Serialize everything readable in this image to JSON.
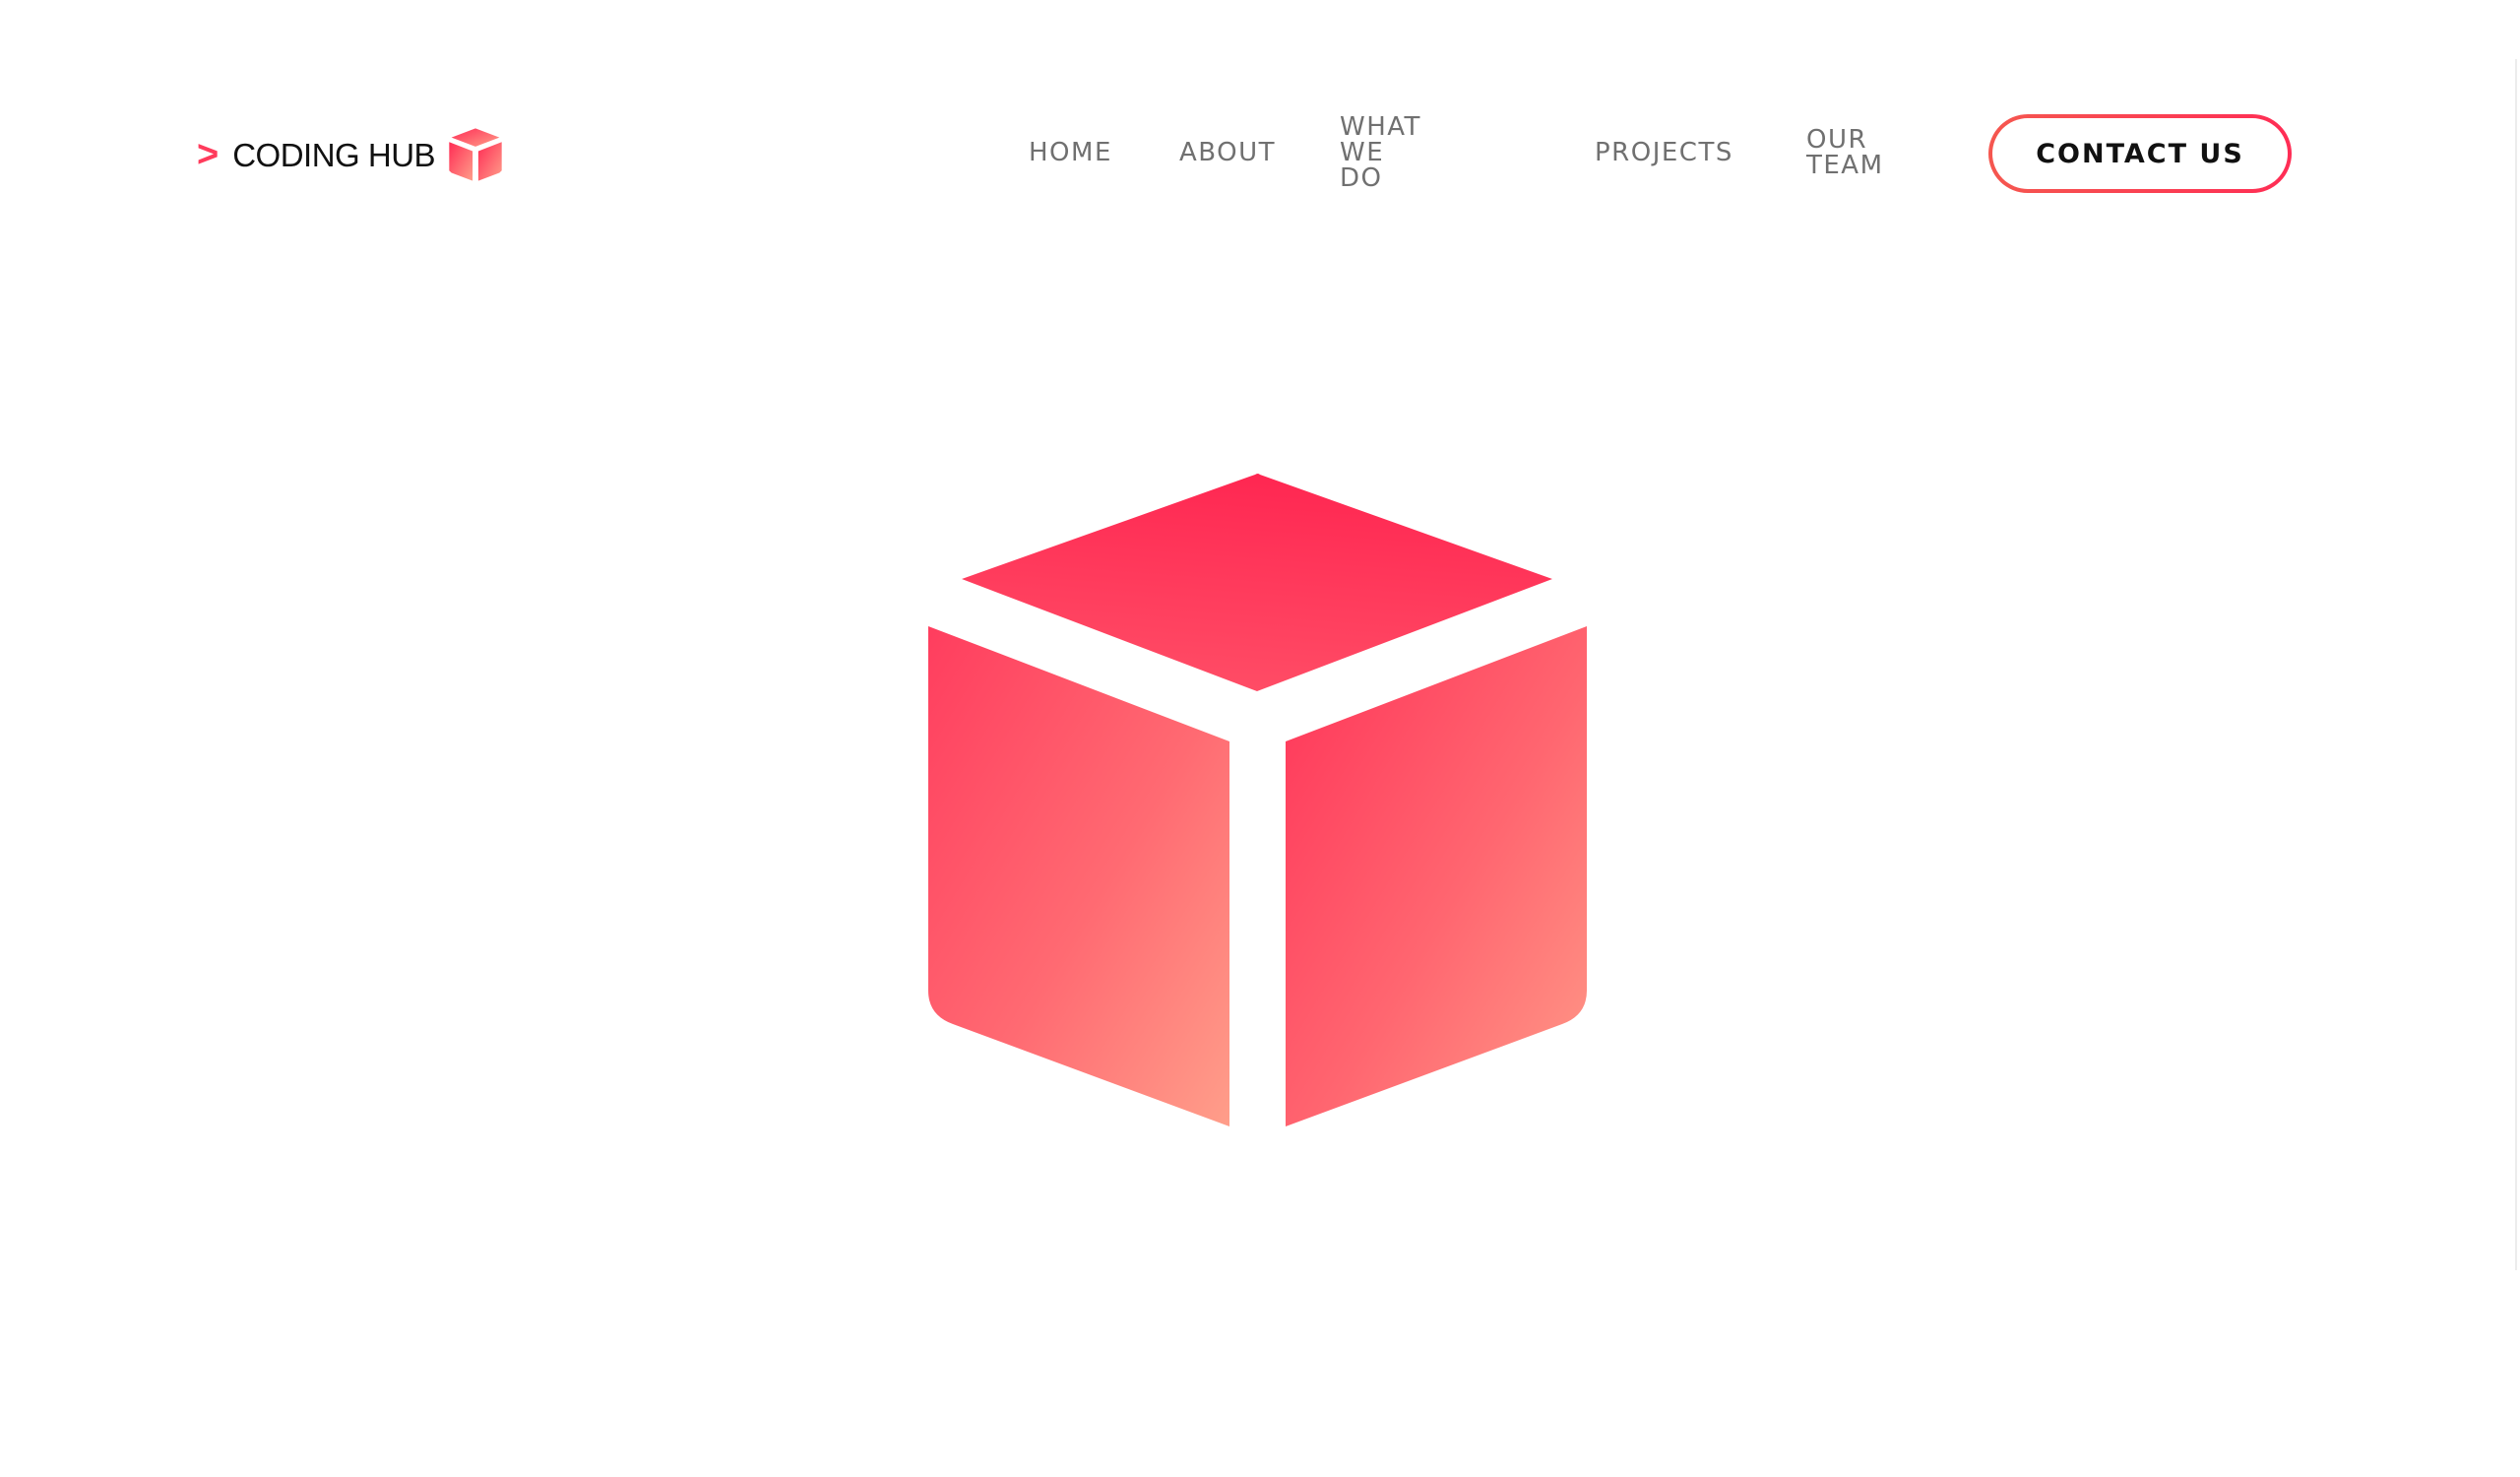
{
  "brand": {
    "arrow": ">",
    "name": "CODING HUB",
    "accent_color": "#ff2d55",
    "gradient_light": "#ff9e8a",
    "icon": "cube-icon"
  },
  "nav": {
    "items": [
      {
        "label": "HOME"
      },
      {
        "label": "ABOUT"
      },
      {
        "label": "WHAT WE DO"
      },
      {
        "label": "PROJECTS"
      },
      {
        "label": "OUR TEAM"
      }
    ],
    "text_color": "#707070"
  },
  "cta": {
    "label": "CONTACT US",
    "border_gradient": [
      "#f5574f",
      "#ff2d55"
    ]
  },
  "hero": {
    "icon": "cube-icon"
  }
}
